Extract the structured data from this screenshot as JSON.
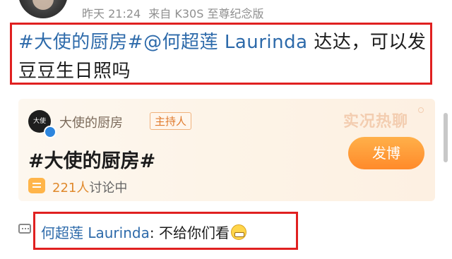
{
  "header": {
    "time_label": "昨天 21:24",
    "source_label": "来自 K30S 至尊纪念版"
  },
  "post": {
    "topic_tag": "#大使的厨房#",
    "mention": "@何超莲 Laurinda",
    "text": " 达达，可以发豆豆生日照吗"
  },
  "topic_card": {
    "account_name": "大使的厨房",
    "host_badge": "主持人",
    "topic_title": "#大使的厨房#",
    "live_chat_label": "实况热聊",
    "post_button_label": "发博",
    "discussion_count": "221人",
    "discussion_label": "讨论中"
  },
  "comment": {
    "author": "何超莲 Laurinda",
    "separator": ": ",
    "text": "不给你们看"
  },
  "colors": {
    "link": "#2d6aaa",
    "accent_orange": "#ff8a2a",
    "highlight_box": "#e02020",
    "meta_gray": "#8f8f8f"
  },
  "icons": {
    "avatar": "user-avatar",
    "verified": "verified-badge-icon",
    "discussion": "chat-bubble-icon",
    "comment": "comment-icon",
    "emoji": "grinning-emoji-icon"
  }
}
